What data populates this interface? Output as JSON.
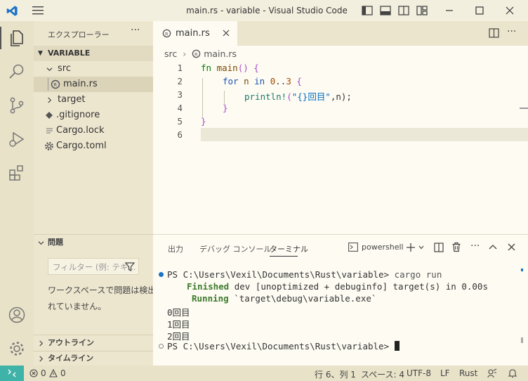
{
  "titlebar": {
    "title": "main.rs - variable - Visual Studio Code"
  },
  "sidebar": {
    "header": "エクスプローラー",
    "more": "···",
    "root": "VARIABLE",
    "items": [
      {
        "label": "src"
      },
      {
        "label": "main.rs"
      },
      {
        "label": "target"
      },
      {
        "label": ".gitignore"
      },
      {
        "label": "Cargo.lock"
      },
      {
        "label": "Cargo.toml"
      }
    ],
    "problems": {
      "title": "問題",
      "filter_placeholder": "フィルター (例: テキ...",
      "message": "ワークスペースで問題は検出されていません。",
      "message_line1": "ワークスペースで問題は検出さ",
      "message_line2": "れていません。"
    },
    "outline": "アウトライン",
    "timeline": "タイムライン"
  },
  "editor": {
    "tab_label": "main.rs",
    "breadcrumb_folder": "src",
    "breadcrumb_file": "main.rs",
    "lines": [
      {
        "n": "1"
      },
      {
        "n": "2"
      },
      {
        "n": "3"
      },
      {
        "n": "4"
      },
      {
        "n": "5"
      },
      {
        "n": "6"
      }
    ],
    "code": {
      "l1_fn": "fn",
      "l1_name": " main",
      "l1_paren": "()",
      "l1_brace": " {",
      "l2_for": "for",
      "l2_n": " n ",
      "l2_in": "in",
      "l2_sp": " ",
      "l2_r0": "0",
      "l2_dots": "..",
      "l2_r3": "3",
      "l2_brace": " {",
      "l3_macro": "println!",
      "l3_open": "(",
      "l3_str": "\"{}回目\"",
      "l3_rest": ",n);",
      "l4": "}",
      "l5": "}"
    }
  },
  "panel": {
    "tabs": [
      "出力",
      "デバッグ コンソール",
      "ターミナル"
    ],
    "shell": "powershell",
    "terminal": {
      "line1_prompt": "PS C:\\Users\\Vexil\\Documents\\Rust\\variable> ",
      "line1_cmd": "cargo run",
      "line2_label": "Finished",
      "line2_rest": " dev [unoptimized + debuginfo] target(s) in 0.00s",
      "line3_label": "Running",
      "line3_rest": " `target\\debug\\variable.exe`",
      "out1": "0回目",
      "out2": "1回目",
      "out3": "2回目",
      "line7_prompt": "PS C:\\Users\\Vexil\\Documents\\Rust\\variable> "
    }
  },
  "status": {
    "errors": "0",
    "warnings": "0",
    "position": "行 6、列 1",
    "spaces": "スペース: 4",
    "encoding": "UTF-8",
    "eol": "LF",
    "language": "Rust"
  },
  "colors": {
    "accent": "#3fb3a8",
    "vscode_blue": "#1a73c9",
    "rust_keyword": "#008000"
  }
}
